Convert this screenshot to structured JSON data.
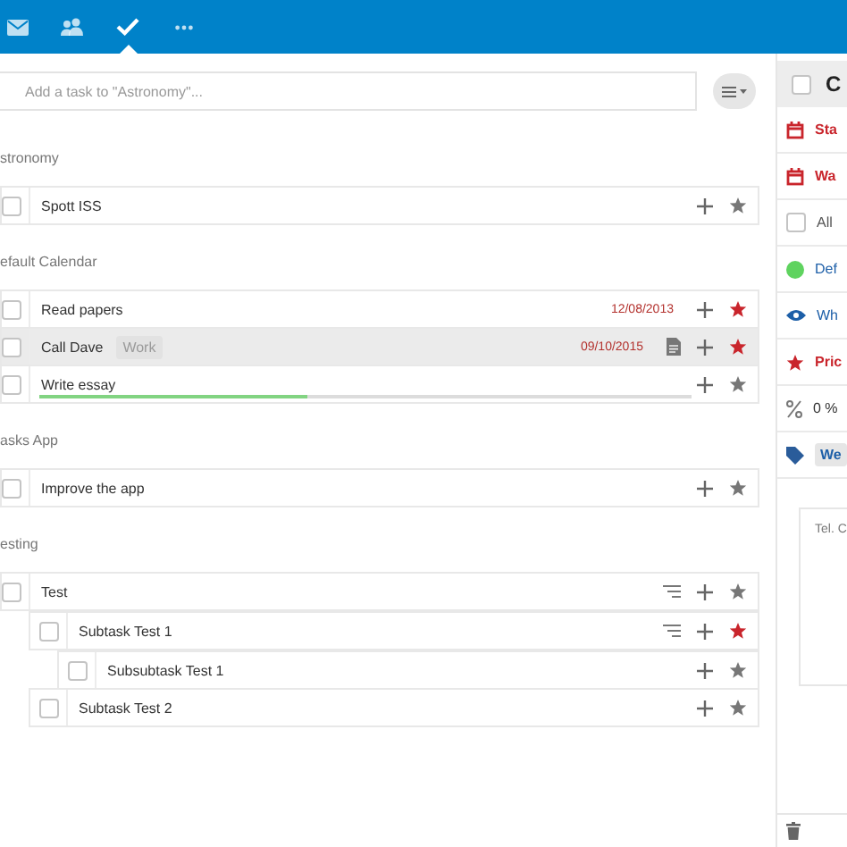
{
  "nav": [
    {
      "kind": "mail",
      "selected": false
    },
    {
      "kind": "contacts",
      "selected": false
    },
    {
      "kind": "tasks",
      "selected": true
    },
    {
      "kind": "more",
      "selected": false
    }
  ],
  "add_task": {
    "placeholder": "Add a task to \"Astronomy\"..."
  },
  "groups": [
    {
      "heading": "stronomy",
      "tasks": [
        {
          "title": "Spott ISS",
          "checked": false,
          "starred": false,
          "selected": false,
          "has_note": false,
          "has_subtasks": false
        }
      ]
    },
    {
      "heading": "efault Calendar",
      "tasks": [
        {
          "title": "Read papers",
          "due": "12/08/2013",
          "checked": false,
          "starred": true,
          "selected": false,
          "has_note": false,
          "has_subtasks": false
        },
        {
          "title": "Call Dave",
          "tag": "Work",
          "due": "09/10/2015",
          "checked": false,
          "starred": true,
          "selected": true,
          "has_note": true,
          "has_subtasks": false
        },
        {
          "title": "Write essay",
          "level": 0.41,
          "checked": false,
          "starred": false,
          "selected": false,
          "has_note": false,
          "has_subtasks": false
        }
      ]
    },
    {
      "heading": "asks App",
      "tasks": [
        {
          "title": "Improve the app",
          "checked": false,
          "starred": false,
          "selected": false,
          "has_note": false,
          "has_subtasks": false
        }
      ]
    },
    {
      "heading": "esting",
      "tasks": [
        {
          "title": "Test",
          "checked": false,
          "starred": false,
          "selected": false,
          "has_note": false,
          "has_subtasks": true,
          "children": [
            {
              "title": "Subtask Test 1",
              "checked": false,
              "starred": true,
              "selected": false,
              "has_note": false,
              "has_subtasks": true,
              "children": [
                {
                  "title": "Subsubtask Test 1",
                  "checked": false,
                  "starred": false,
                  "selected": false,
                  "has_note": false,
                  "has_subtasks": false
                }
              ]
            },
            {
              "title": "Subtask Test 2",
              "checked": false,
              "starred": false,
              "selected": false,
              "has_note": false,
              "has_subtasks": false
            }
          ]
        }
      ]
    }
  ],
  "details": {
    "title": "C",
    "checked": false,
    "rows": [
      {
        "kind": "start",
        "text": "Sta"
      },
      {
        "kind": "due",
        "text": "Wa"
      },
      {
        "kind": "allday",
        "text": "All",
        "checked": false
      },
      {
        "kind": "calendar",
        "text": "Def",
        "color": "#5fd35f"
      },
      {
        "kind": "visibility",
        "text": "Wh"
      },
      {
        "kind": "priority",
        "text": "Pric"
      },
      {
        "kind": "percent",
        "text": "0 %"
      },
      {
        "kind": "tags",
        "text": "We"
      }
    ],
    "note": "Tel. C"
  }
}
